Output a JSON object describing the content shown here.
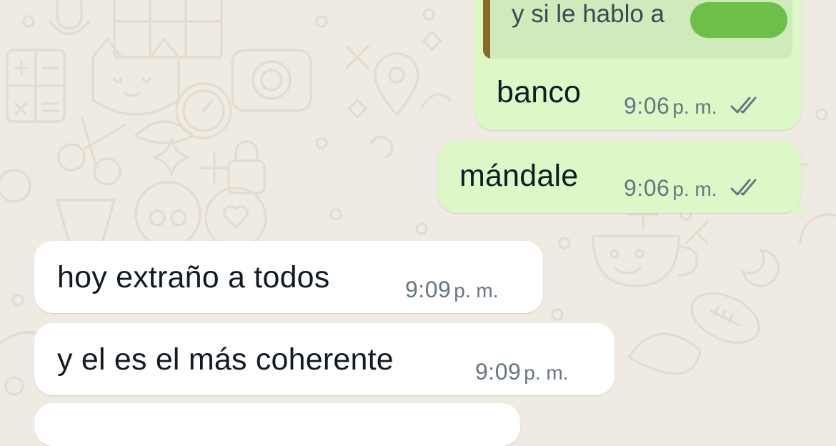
{
  "chat": {
    "reply_preview": {
      "quoted_text": "y si le hablo a",
      "redacted": true
    },
    "messages": [
      {
        "direction": "outgoing",
        "text": "banco",
        "time": "9:06",
        "ampm": "p. m.",
        "status": "read-double-check"
      },
      {
        "direction": "outgoing",
        "text": "mándale",
        "time": "9:06",
        "ampm": "p. m.",
        "status": "read-double-check"
      },
      {
        "direction": "incoming",
        "text": "hoy extraño a todos",
        "time": "9:09",
        "ampm": "p. m."
      },
      {
        "direction": "incoming",
        "text": "y el es el más coherente",
        "time": "9:09",
        "ampm": "p. m."
      }
    ]
  },
  "colors": {
    "background": "#EFEAE2",
    "outgoing_bubble": "#DCF8C6",
    "incoming_bubble": "#FFFFFF",
    "quote_accent": "#8A6A24",
    "redaction": "#6CC04A",
    "meta_text": "#667781"
  },
  "icons": [
    "double-check-icon",
    "wallpaper-doodles"
  ]
}
